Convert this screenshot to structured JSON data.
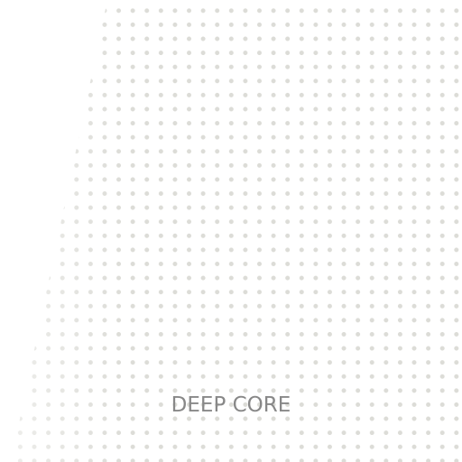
{
  "caption": {
    "text": "DEEP CORE",
    "color": "#888888"
  },
  "pattern": {
    "type": "dot-grid",
    "dot_color": "#dcdcd7",
    "background_color": "#ffffff"
  }
}
